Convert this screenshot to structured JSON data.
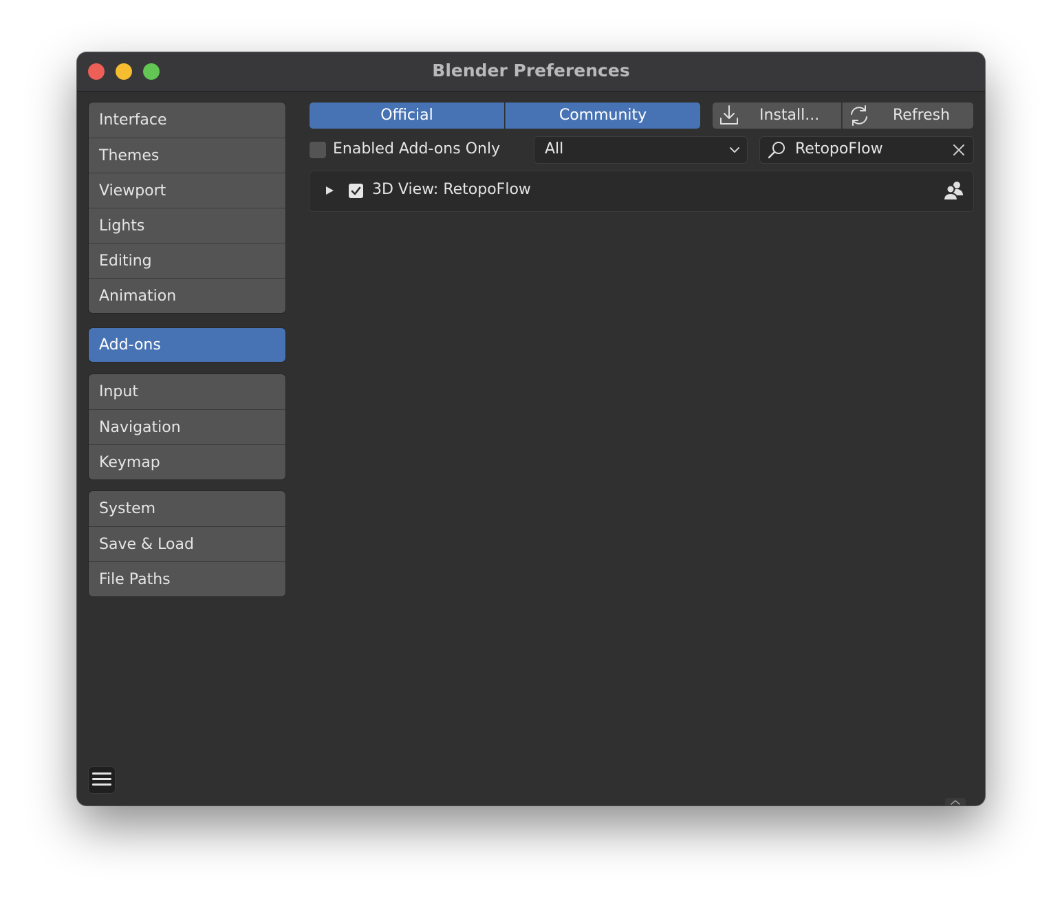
{
  "window": {
    "title": "Blender Preferences"
  },
  "sidebar": {
    "groups": [
      {
        "items": [
          {
            "label": "Interface"
          },
          {
            "label": "Themes"
          },
          {
            "label": "Viewport"
          },
          {
            "label": "Lights"
          },
          {
            "label": "Editing"
          },
          {
            "label": "Animation"
          }
        ]
      },
      {
        "items": [
          {
            "label": "Add-ons",
            "active": true
          }
        ]
      },
      {
        "items": [
          {
            "label": "Input"
          },
          {
            "label": "Navigation"
          },
          {
            "label": "Keymap"
          }
        ]
      },
      {
        "items": [
          {
            "label": "System"
          },
          {
            "label": "Save & Load"
          },
          {
            "label": "File Paths"
          }
        ]
      }
    ]
  },
  "toolbar": {
    "support_tabs": [
      "Official",
      "Community"
    ],
    "install_label": "Install...",
    "refresh_label": "Refresh"
  },
  "filters": {
    "enabled_only_label": "Enabled Add-ons Only",
    "enabled_only_checked": false,
    "category_value": "All",
    "search_value": "RetopoFlow"
  },
  "addons": [
    {
      "name": "3D View: RetopoFlow",
      "enabled": true,
      "expanded": false,
      "support_icon": "community-icon"
    }
  ],
  "colors": {
    "accent": "#4772b3",
    "window_bg": "#303030",
    "button_bg": "#545454"
  }
}
